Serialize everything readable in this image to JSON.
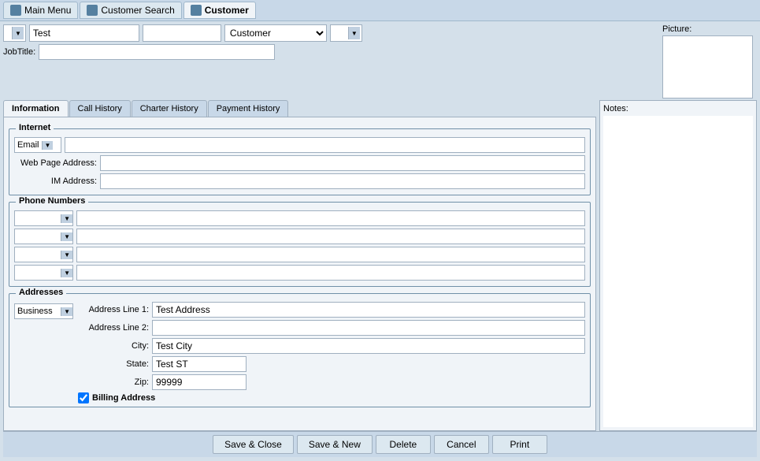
{
  "titlebar": {
    "tabs": [
      {
        "label": "Main Menu",
        "active": false,
        "icon": "menu-icon"
      },
      {
        "label": "Customer Search",
        "active": false,
        "icon": "search-icon"
      },
      {
        "label": "Customer",
        "active": true,
        "icon": "customer-icon"
      }
    ]
  },
  "header": {
    "prefix_placeholder": "",
    "first_name": "Test",
    "last_name_placeholder": "",
    "customer_type": "Customer",
    "suffix_placeholder": "",
    "jobtitle_label": "JobTitle:",
    "jobtitle_value": "",
    "picture_label": "Picture:"
  },
  "tabs": {
    "active": "Information",
    "items": [
      "Information",
      "Call History",
      "Charter History",
      "Payment History"
    ]
  },
  "internet": {
    "section_label": "Internet",
    "email_label": "Email",
    "email_value": "",
    "email_dropdown_arrow": "▼",
    "webpage_label": "Web Page Address:",
    "webpage_value": "",
    "im_label": "IM Address:",
    "im_value": ""
  },
  "phone_numbers": {
    "section_label": "Phone Numbers",
    "rows": [
      {
        "type": "",
        "number": ""
      },
      {
        "type": "",
        "number": ""
      },
      {
        "type": "",
        "number": ""
      },
      {
        "type": "",
        "number": ""
      }
    ]
  },
  "addresses": {
    "section_label": "Addresses",
    "address_type": "Business",
    "address_type_arrow": "▼",
    "address_line1_label": "Address Line 1:",
    "address_line1_value": "Test Address",
    "address_line2_label": "Address Line 2:",
    "address_line2_value": "",
    "city_label": "City:",
    "city_value": "Test City",
    "state_label": "State:",
    "state_value": "Test ST",
    "zip_label": "Zip:",
    "zip_value": "99999",
    "billing_checked": true,
    "billing_label": "Billing Address"
  },
  "notes": {
    "label": "Notes:",
    "value": ""
  },
  "buttons": {
    "save_close": "Save & Close",
    "save_new": "Save & New",
    "delete": "Delete",
    "cancel": "Cancel",
    "print": "Print"
  }
}
